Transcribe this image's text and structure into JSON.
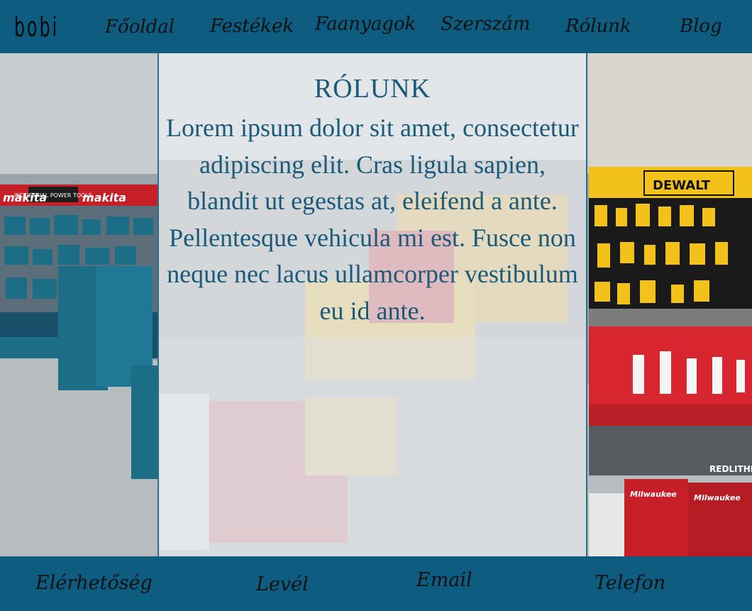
{
  "brand": {
    "logo": "bobi"
  },
  "nav": {
    "items": [
      {
        "label": "Főoldal"
      },
      {
        "label": "Festékek"
      },
      {
        "label": "Faanyagok"
      },
      {
        "label": "Szerszám"
      },
      {
        "label": "Rólunk"
      },
      {
        "label": "Blog"
      }
    ]
  },
  "about": {
    "title": "RÓLUNK",
    "body": "Lorem ipsum dolor sit amet, consectetur adipiscing elit. Cras ligula sapien, blandit ut egestas at, eleifend a ante. Pellentesque vehicula mi est. Fusce non neque nec lacus ullamcorper vestibulum eu id ante."
  },
  "hero_signs": {
    "industrial": "INDUSTRIAL POWER TOOLS",
    "makita": "makita",
    "dewalt": "DEWALT",
    "milwaukee": "Milwaukee",
    "redlithium": "REDLITHIUM"
  },
  "footer": {
    "items": [
      {
        "label": "Elérhetőség"
      },
      {
        "label": "Levél"
      },
      {
        "label": "Email"
      },
      {
        "label": "Telefon"
      }
    ]
  },
  "colors": {
    "bar": "#0e5c80",
    "panel_text": "#1a5a78",
    "dewalt_yellow": "#f2c21a",
    "makita_teal": "#1b6e86",
    "milwaukee_red": "#d7262f"
  }
}
